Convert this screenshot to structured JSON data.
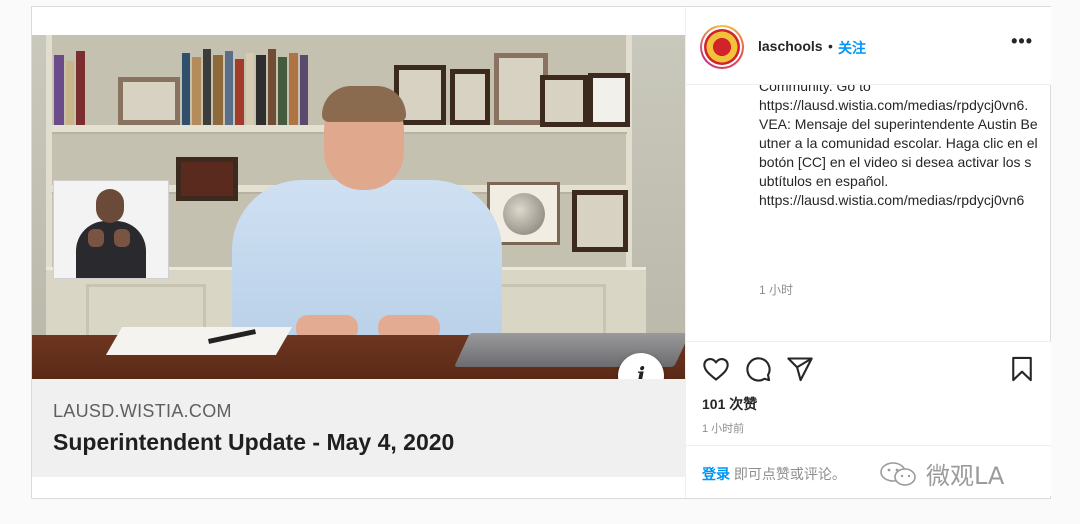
{
  "media": {
    "link_card": {
      "domain": "LAUSD.WISTIA.COM",
      "title": "Superintendent Update - May 4, 2020"
    },
    "info_label": "i"
  },
  "header": {
    "username": "laschools",
    "separator": "•",
    "follow_label": "关注",
    "more_label": "•••"
  },
  "caption": {
    "text": "Community. Go to\nhttps://lausd.wistia.com/medias/rpdycj0vn6.\nVEA: Mensaje del superintendente Austin Beutner a la comunidad escolar. Haga clic en el botón [CC] en el video si desea activar los subtítulos en español.\nhttps://lausd.wistia.com/medias/rpdycj0vn6",
    "time": "1 小时"
  },
  "actions": {
    "icons": [
      "heart-icon",
      "comment-icon",
      "share-icon",
      "bookmark-icon"
    ],
    "likes": "101 次赞",
    "time_ago": "1 小时前",
    "login_link": "登录",
    "login_suffix": " 即可点赞或评论。"
  },
  "watermark": {
    "text": "微观LA"
  }
}
